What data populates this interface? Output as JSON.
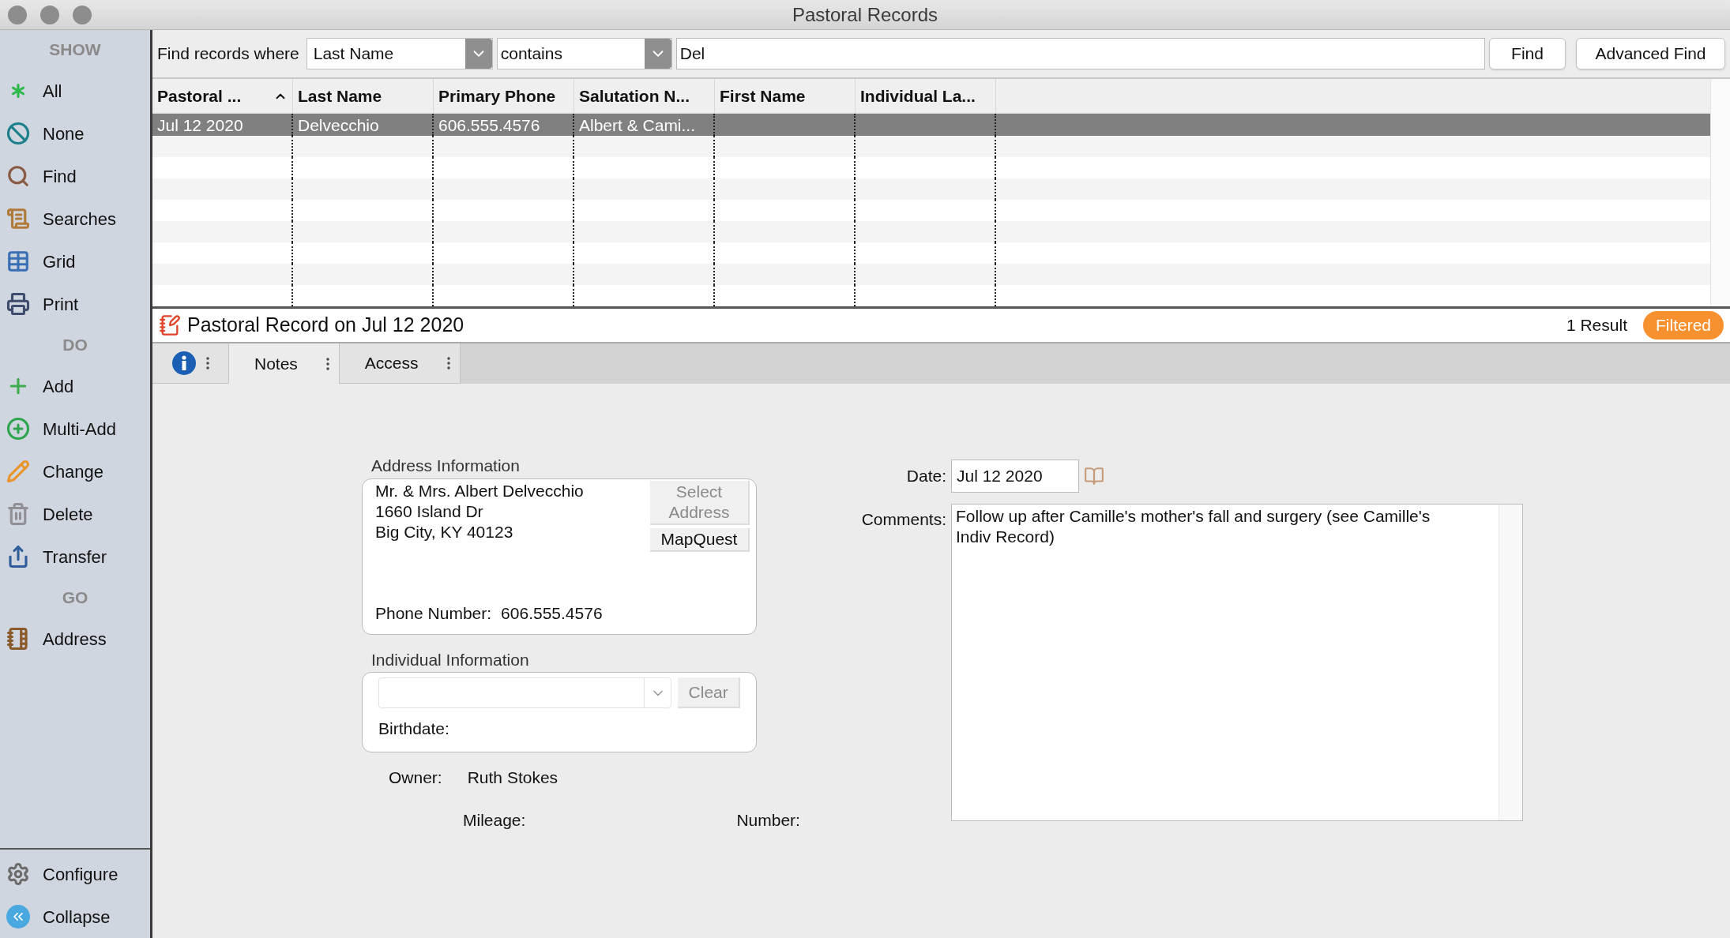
{
  "window": {
    "title": "Pastoral Records"
  },
  "sidebar": {
    "sections": [
      {
        "heading": "SHOW",
        "items": [
          {
            "label": "All",
            "kind": "all"
          },
          {
            "label": "None",
            "kind": "none"
          },
          {
            "label": "Find",
            "kind": "find"
          },
          {
            "label": "Searches",
            "kind": "searches"
          },
          {
            "label": "Grid",
            "kind": "grid"
          },
          {
            "label": "Print",
            "kind": "print"
          }
        ]
      },
      {
        "heading": "DO",
        "items": [
          {
            "label": "Add",
            "kind": "add"
          },
          {
            "label": "Multi-Add",
            "kind": "multiadd"
          },
          {
            "label": "Change",
            "kind": "change"
          },
          {
            "label": "Delete",
            "kind": "delete"
          },
          {
            "label": "Transfer",
            "kind": "transfer"
          }
        ]
      },
      {
        "heading": "GO",
        "items": [
          {
            "label": "Address",
            "kind": "address"
          }
        ]
      }
    ],
    "footer_items": [
      {
        "label": "Configure",
        "kind": "configure"
      },
      {
        "label": "Collapse",
        "kind": "collapse"
      }
    ]
  },
  "search": {
    "label": "Find records where",
    "field": "Last Name",
    "operator": "contains",
    "value": "Del",
    "buttons": [
      "Find",
      "Advanced Find"
    ]
  },
  "table": {
    "columns": [
      {
        "label": "Pastoral ...",
        "sorted": true
      },
      {
        "label": "Last Name",
        "sorted": false
      },
      {
        "label": "Primary Phone",
        "sorted": false
      },
      {
        "label": "Salutation N...",
        "sorted": false
      },
      {
        "label": "First Name",
        "sorted": false
      },
      {
        "label": "Individual La...",
        "sorted": false
      }
    ],
    "rows": [
      {
        "cells": [
          "Jul 12 2020",
          "Delvecchio",
          "606.555.4576",
          "Albert & Cami...",
          "",
          ""
        ],
        "selected": true
      }
    ]
  },
  "record": {
    "title": "Pastoral Record on Jul 12 2020",
    "result_count": "1 Result",
    "filter_badge": "Filtered"
  },
  "tabs": [
    {
      "kind": "info",
      "selected": false
    },
    {
      "kind": "text",
      "label": "Notes",
      "selected": true
    },
    {
      "kind": "text",
      "label": "Access",
      "selected": false
    }
  ],
  "address": {
    "heading": "Address Information",
    "lines": [
      "Mr. & Mrs. Albert Delvecchio",
      "1660 Island Dr",
      "Big City, KY 40123"
    ],
    "buttons": [
      {
        "label": "Select Address",
        "disabled": true
      },
      {
        "label": "MapQuest",
        "disabled": false
      }
    ],
    "phone_label": "Phone Number:",
    "phone": "606.555.4576"
  },
  "individual": {
    "heading": "Individual Information",
    "clear_button": {
      "label": "Clear",
      "disabled": true
    },
    "birthdate_label": "Birthdate:"
  },
  "owner": {
    "label": "Owner:",
    "value": "Ruth Stokes"
  },
  "mileage_label": "Mileage:",
  "number_label": "Number:",
  "date": {
    "label": "Date:",
    "value": "Jul 12 2020"
  },
  "comments": {
    "label": "Comments:",
    "value": "Follow up after Camille's mother's fall and surgery (see Camille's Indiv Record)"
  }
}
